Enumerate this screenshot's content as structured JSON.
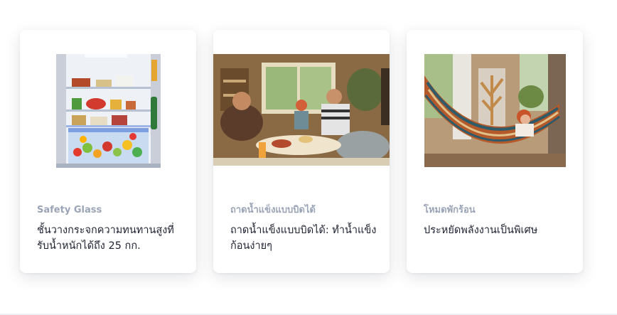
{
  "cards": [
    {
      "eyebrow": "Safety Glass",
      "description": "ชั้นวางกระจกความทนทานสูงที่รับน้ำหนักได้ถึง 25 กก.",
      "image_icon": "refrigerator-interior-photo"
    },
    {
      "eyebrow": "ถาดน้ำแข็งแบบบิดได้",
      "description": "ถาดน้ำแข็งแบบบิดได้: ทำน้ำแข็งก้อนง่ายๆ",
      "image_icon": "friends-gathering-photo"
    },
    {
      "eyebrow": "โหมดพักร้อน",
      "description": "ประหยัดพลังงานเป็นพิเศษ",
      "image_icon": "woman-in-hammock-photo"
    }
  ]
}
